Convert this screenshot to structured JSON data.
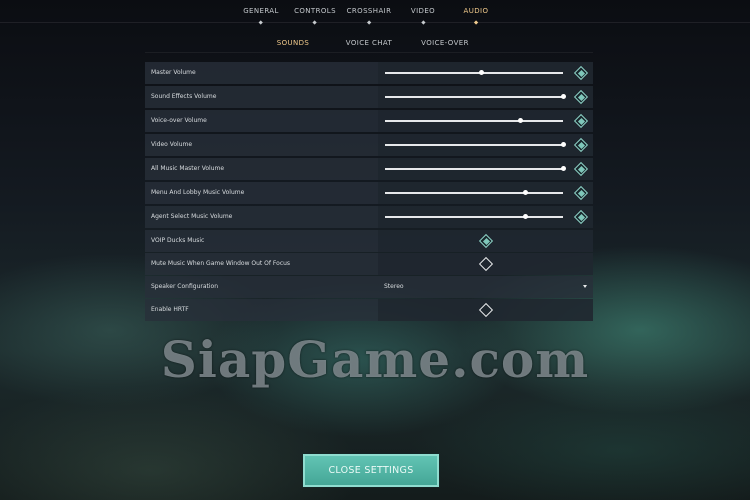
{
  "nav": {
    "tabs": [
      {
        "label": "GENERAL",
        "active": false
      },
      {
        "label": "CONTROLS",
        "active": false
      },
      {
        "label": "CROSSHAIR",
        "active": false
      },
      {
        "label": "VIDEO",
        "active": false
      },
      {
        "label": "AUDIO",
        "active": true
      }
    ]
  },
  "subnav": {
    "tabs": [
      {
        "label": "SOUNDS",
        "active": true
      },
      {
        "label": "VOICE CHAT",
        "active": false
      },
      {
        "label": "VOICE-OVER",
        "active": false
      }
    ]
  },
  "settings": [
    {
      "label": "Master Volume",
      "type": "slider",
      "value_fraction": 0.54
    },
    {
      "label": "Sound Effects Volume",
      "type": "slider",
      "value_fraction": 1.0
    },
    {
      "label": "Voice-over Volume",
      "type": "slider",
      "value_fraction": 0.76
    },
    {
      "label": "Video Volume",
      "type": "slider",
      "value_fraction": 1.0
    },
    {
      "label": "All Music Master Volume",
      "type": "slider",
      "value_fraction": 1.0
    },
    {
      "label": "Menu And Lobby Music Volume",
      "type": "slider",
      "value_fraction": 0.79
    },
    {
      "label": "Agent Select Music Volume",
      "type": "slider",
      "value_fraction": 0.79
    },
    {
      "label": "VOIP Ducks Music",
      "type": "checkbox",
      "checked": true
    },
    {
      "label": "Mute Music When Game Window Out Of Focus",
      "type": "checkbox",
      "checked": false
    },
    {
      "label": "Speaker Configuration",
      "type": "select",
      "value": "Stereo"
    },
    {
      "label": "Enable HRTF",
      "type": "checkbox",
      "checked": false
    }
  ],
  "watermark": "SiapGame.com",
  "close_button": {
    "label": "CLOSE SETTINGS"
  },
  "colors": {
    "accent": "#f0c98b",
    "teal": "#7fc7ba",
    "button": "#55b5a5"
  },
  "icons": {
    "reset": "diamond-reset-icon",
    "checkbox": "diamond-checkbox-icon",
    "dropdown": "chevron-down-icon"
  }
}
